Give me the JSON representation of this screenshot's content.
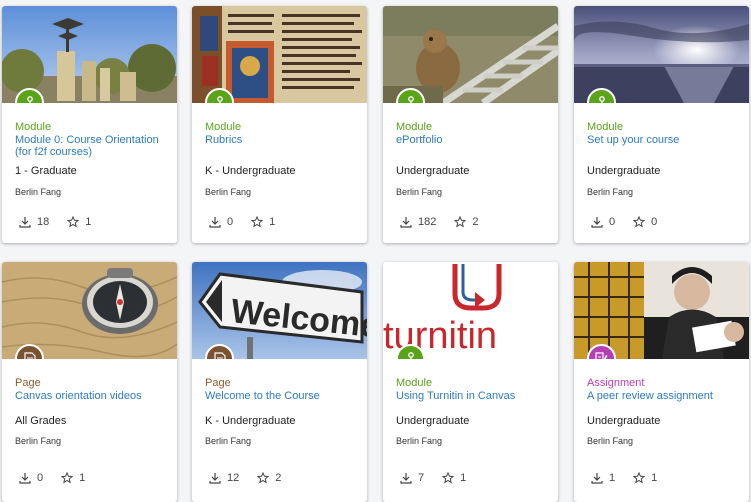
{
  "cards": [
    {
      "type": "Module",
      "title": "Module 0: Course Orientation (for f2f courses)",
      "grade": "1 - Graduate",
      "author": "Berlin Fang",
      "downloads": "18",
      "favorites": "1",
      "type_color": "#5aa41a",
      "icon": "module-icon"
    },
    {
      "type": "Module",
      "title": "Rubrics",
      "grade": "K - Undergraduate",
      "author": "Berlin Fang",
      "downloads": "0",
      "favorites": "1",
      "type_color": "#5aa41a",
      "icon": "module-icon"
    },
    {
      "type": "Module",
      "title": "ePortfolio",
      "grade": "Undergraduate",
      "author": "Berlin Fang",
      "downloads": "182",
      "favorites": "2",
      "type_color": "#5aa41a",
      "icon": "module-icon"
    },
    {
      "type": "Module",
      "title": "Set up your course",
      "grade": "Undergraduate",
      "author": "Berlin Fang",
      "downloads": "0",
      "favorites": "0",
      "type_color": "#5aa41a",
      "icon": "module-icon"
    },
    {
      "type": "Page",
      "title": "Canvas orientation videos",
      "grade": "All Grades",
      "author": "Berlin Fang",
      "downloads": "0",
      "favorites": "1",
      "type_color": "#8a5a2b",
      "icon": "page-icon"
    },
    {
      "type": "Page",
      "title": "Welcome to the Course",
      "grade": "K - Undergraduate",
      "author": "Berlin Fang",
      "downloads": "12",
      "favorites": "2",
      "type_color": "#8a5a2b",
      "icon": "page-icon"
    },
    {
      "type": "Module",
      "title": "Using Turnitin in Canvas",
      "grade": "Undergraduate",
      "author": "Berlin Fang",
      "downloads": "7",
      "favorites": "1",
      "type_color": "#5aa41a",
      "icon": "module-icon"
    },
    {
      "type": "Assignment",
      "title": "A peer review assignment",
      "grade": "Undergraduate",
      "author": "Berlin Fang",
      "downloads": "1",
      "favorites": "1",
      "type_color": "#b43fb4",
      "icon": "assignment-icon"
    }
  ],
  "images": {
    "welcome_sign_text": "Welcome",
    "turnitin_logo_text": "turnitin"
  }
}
